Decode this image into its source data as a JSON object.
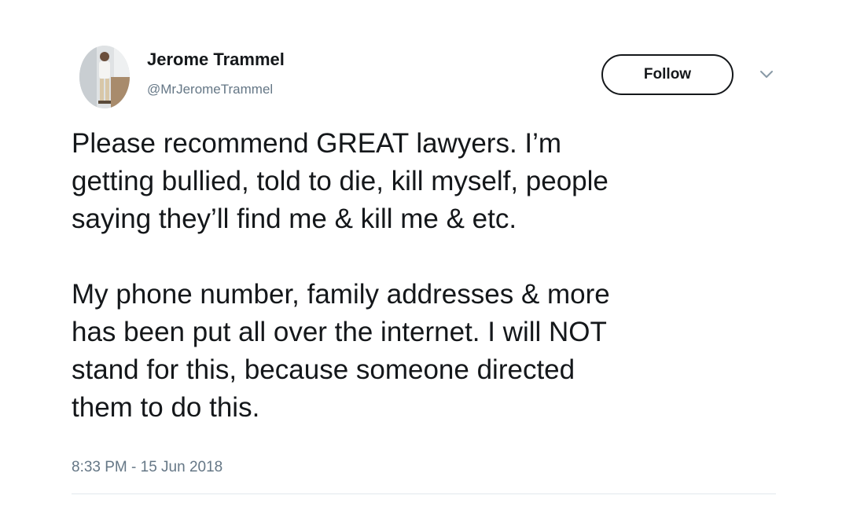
{
  "author": {
    "name": "Jerome Trammel",
    "handle": "@MrJeromeTrammel"
  },
  "actions": {
    "follow_label": "Follow",
    "more_icon": "chevron-down-icon"
  },
  "tweet": {
    "paragraphs": [
      "Please recommend GREAT lawyers. I’m\ngetting bullied, told to die, kill myself, people\nsaying they’ll find me & kill me & etc.",
      "My phone number, family addresses & more\nhas been put all over the internet. I will NOT\nstand for this, because someone directed\nthem to do this."
    ],
    "timestamp": "8:33 PM - 15 Jun 2018"
  },
  "colors": {
    "text": "#14171a",
    "secondary": "#657786",
    "divider": "#e1e8ed"
  }
}
